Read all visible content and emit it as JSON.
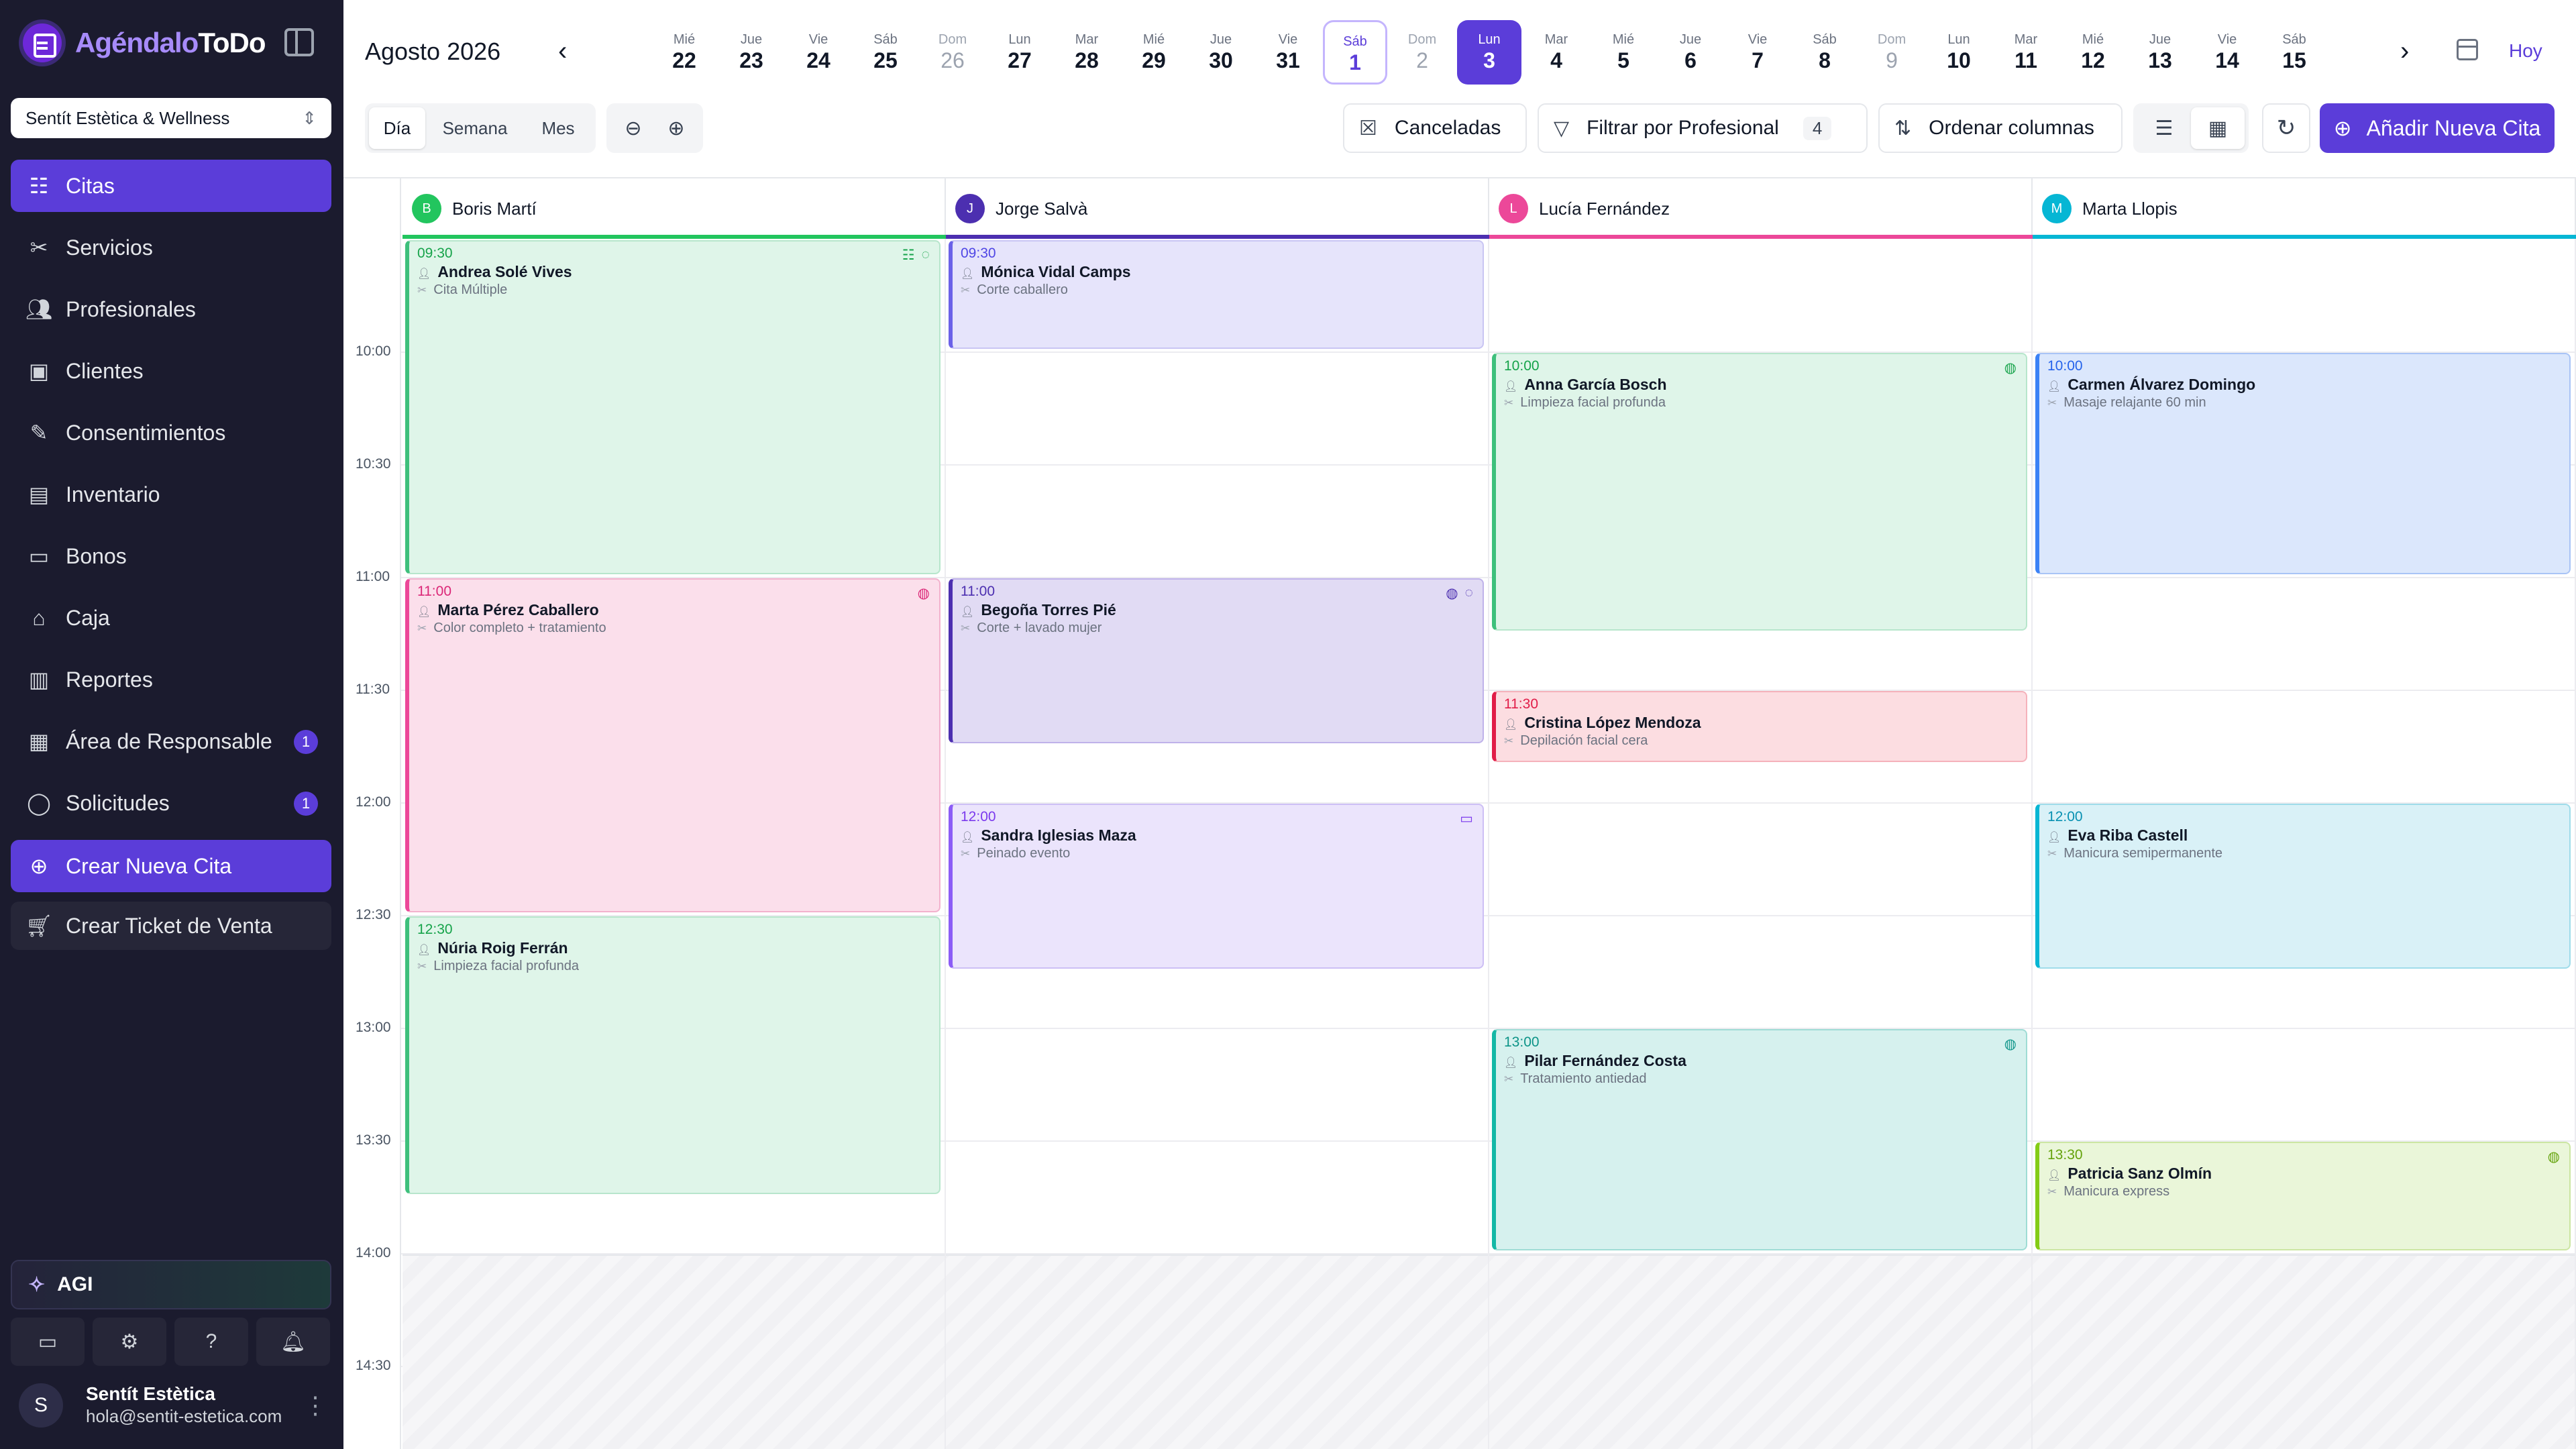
{
  "app": {
    "brand_part1": "Agéndalo",
    "brand_part2": "ToDo",
    "business": "Sentít Estètica & Wellness"
  },
  "nav": [
    {
      "label": "Citas",
      "icon": "list-check-icon"
    },
    {
      "label": "Servicios",
      "icon": "scissors-icon"
    },
    {
      "label": "Profesionales",
      "icon": "users-icon"
    },
    {
      "label": "Clientes",
      "icon": "id-card-icon"
    },
    {
      "label": "Consentimientos",
      "icon": "document-edit-icon"
    },
    {
      "label": "Inventario",
      "icon": "archive-icon"
    },
    {
      "label": "Bonos",
      "icon": "ticket-icon"
    },
    {
      "label": "Caja",
      "icon": "bank-icon"
    },
    {
      "label": "Reportes",
      "icon": "bar-chart-icon"
    },
    {
      "label": "Área de Responsable",
      "icon": "building-icon",
      "badge": "1"
    },
    {
      "label": "Solicitudes",
      "icon": "message-icon",
      "badge": "1"
    }
  ],
  "actions": {
    "new_appt": "Crear Nueva Cita",
    "new_ticket": "Crear Ticket de Venta"
  },
  "agi": "AGI",
  "user": {
    "initial": "S",
    "name": "Sentít Estètica",
    "email": "hola@sentit-estetica.com"
  },
  "header": {
    "month": "Agosto 2026",
    "today": "Hoy",
    "days": [
      {
        "n": "Mié",
        "d": "22"
      },
      {
        "n": "Jue",
        "d": "23"
      },
      {
        "n": "Vie",
        "d": "24"
      },
      {
        "n": "Sáb",
        "d": "25"
      },
      {
        "n": "Dom",
        "d": "26"
      },
      {
        "n": "Lun",
        "d": "27"
      },
      {
        "n": "Mar",
        "d": "28"
      },
      {
        "n": "Mié",
        "d": "29"
      },
      {
        "n": "Jue",
        "d": "30"
      },
      {
        "n": "Vie",
        "d": "31"
      },
      {
        "n": "Sáb",
        "d": "1"
      },
      {
        "n": "Dom",
        "d": "2"
      },
      {
        "n": "Lun",
        "d": "3"
      },
      {
        "n": "Mar",
        "d": "4"
      },
      {
        "n": "Mié",
        "d": "5"
      },
      {
        "n": "Jue",
        "d": "6"
      },
      {
        "n": "Vie",
        "d": "7"
      },
      {
        "n": "Sáb",
        "d": "8"
      },
      {
        "n": "Dom",
        "d": "9"
      },
      {
        "n": "Lun",
        "d": "10"
      },
      {
        "n": "Mar",
        "d": "11"
      },
      {
        "n": "Mié",
        "d": "12"
      },
      {
        "n": "Jue",
        "d": "13"
      },
      {
        "n": "Vie",
        "d": "14"
      },
      {
        "n": "Sáb",
        "d": "15"
      }
    ]
  },
  "toolbar": {
    "views": [
      "Día",
      "Semana",
      "Mes"
    ],
    "cancelled": "Canceladas",
    "filter": "Filtrar por Profesional",
    "filter_count": "4",
    "sort": "Ordenar columnas",
    "add": "Añadir Nueva Cita"
  },
  "times": [
    "10:00",
    "10:30",
    "11:00",
    "11:30",
    "12:00",
    "12:30",
    "13:00",
    "13:30",
    "14:00",
    "14:30"
  ],
  "professionals": [
    {
      "initial": "B",
      "name": "Boris Martí",
      "color": "#22c55e"
    },
    {
      "initial": "J",
      "name": "Jorge Salvà",
      "color": "#4c2fb0"
    },
    {
      "initial": "L",
      "name": "Lucía Fernández",
      "color": "#ec4899"
    },
    {
      "initial": "M",
      "name": "Marta Llopis",
      "color": "#06b6d4"
    }
  ],
  "appointments": [
    {
      "col": 0,
      "time": "09:30",
      "end": "11:00",
      "client": "Andrea Solé Vives",
      "service": "Cita Múltiple",
      "style": "green",
      "icons": [
        "list-icon",
        "chat-icon"
      ]
    },
    {
      "col": 0,
      "time": "11:00",
      "end": "12:30",
      "client": "Marta Pérez Caballero",
      "service": "Color completo + tratamiento",
      "style": "pink",
      "icons": [
        "globe-icon"
      ]
    },
    {
      "col": 0,
      "time": "12:30",
      "end": "13:45",
      "client": "Núria Roig Ferrán",
      "service": "Limpieza facial profunda",
      "style": "green",
      "icons": []
    },
    {
      "col": 1,
      "time": "09:30",
      "end": "10:00",
      "client": "Mónica Vidal Camps",
      "service": "Corte caballero",
      "style": "lav",
      "icons": []
    },
    {
      "col": 1,
      "time": "11:00",
      "end": "11:45",
      "client": "Begoña Torres Pié",
      "service": "Corte + lavado mujer",
      "style": "purple",
      "icons": [
        "globe-icon",
        "chat-icon"
      ]
    },
    {
      "col": 1,
      "time": "12:00",
      "end": "12:45",
      "client": "Sandra Iglesias Maza",
      "service": "Peinado evento",
      "style": "violet",
      "icons": [
        "ticket-icon"
      ]
    },
    {
      "col": 2,
      "time": "10:00",
      "end": "11:15",
      "client": "Anna García Bosch",
      "service": "Limpieza facial profunda",
      "style": "green",
      "icons": [
        "globe-icon"
      ]
    },
    {
      "col": 2,
      "time": "11:30",
      "end": "11:50",
      "client": "Cristina López Mendoza",
      "service": "Depilación facial cera",
      "style": "red",
      "icons": []
    },
    {
      "col": 2,
      "time": "13:00",
      "end": "14:00",
      "client": "Pilar Fernández Costa",
      "service": "Tratamiento antiedad",
      "style": "teal",
      "icons": [
        "globe-icon"
      ]
    },
    {
      "col": 3,
      "time": "10:00",
      "end": "11:00",
      "client": "Carmen Álvarez Domingo",
      "service": "Masaje relajante 60 min",
      "style": "blue",
      "icons": []
    },
    {
      "col": 3,
      "time": "12:00",
      "end": "12:45",
      "client": "Eva Riba Castell",
      "service": "Manicura semipermanente",
      "style": "cyan",
      "icons": []
    },
    {
      "col": 3,
      "time": "13:30",
      "end": "14:00",
      "client": "Patricia Sanz Olmín",
      "service": "Manicura express",
      "style": "lime",
      "icons": [
        "globe-icon"
      ]
    }
  ]
}
